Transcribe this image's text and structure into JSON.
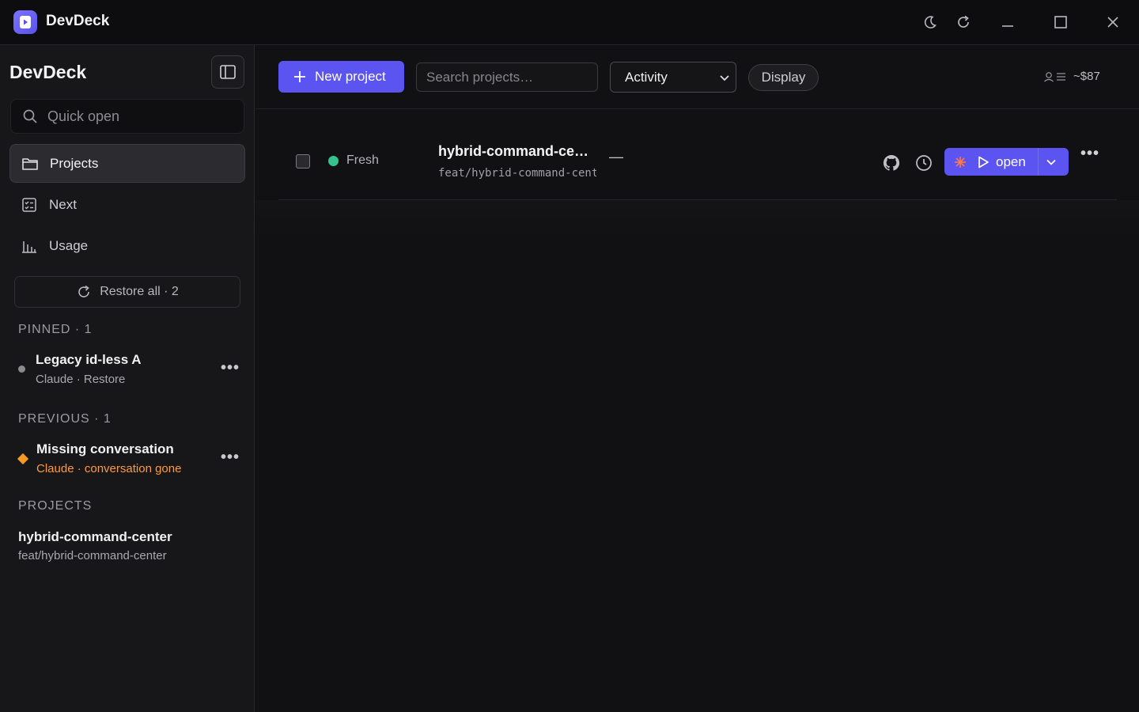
{
  "window": {
    "app_title": "DevDeck",
    "controls": [
      "theme-toggle",
      "reload",
      "minimize",
      "maximize",
      "close"
    ]
  },
  "sidebar": {
    "title": "DevDeck",
    "quick_open_placeholder": "Quick open",
    "nav": [
      {
        "label": "Projects",
        "icon": "folder-icon",
        "active": true
      },
      {
        "label": "Next",
        "icon": "checklist-icon",
        "active": false
      },
      {
        "label": "Usage",
        "icon": "bar-chart-icon",
        "active": false
      }
    ],
    "restore_label": "Restore all · 2",
    "pinned": {
      "heading": "PINNED · 1",
      "items": [
        {
          "title": "Legacy id-less A",
          "subtitle": "Claude · Restore",
          "status_color": "#8a8a90"
        }
      ]
    },
    "previous": {
      "heading": "PREVIOUS · 1",
      "items": [
        {
          "title": "Missing conversation",
          "subtitle": "Claude · conversation gone",
          "status_color": "#f59a23"
        }
      ]
    },
    "projects": {
      "heading": "PROJECTS",
      "items": [
        {
          "title": "hybrid-command-center",
          "subtitle": "feat/hybrid-command-center"
        }
      ]
    }
  },
  "toolbar": {
    "new_project_label": "New project",
    "search_placeholder": "Search projects…",
    "sort_value": "Activity",
    "display_label": "Display",
    "cost": "~$87"
  },
  "rows": [
    {
      "status": "Fresh",
      "status_color": "#34c38f",
      "name": "hybrid-command-ce…",
      "branch": "feat/hybrid-command-center",
      "dash": "—",
      "open_label": "open"
    }
  ],
  "colors": {
    "accent": "#5b54f0",
    "background": "#111113",
    "sidebar": "#17171a",
    "warning": "#ff9a3c"
  }
}
